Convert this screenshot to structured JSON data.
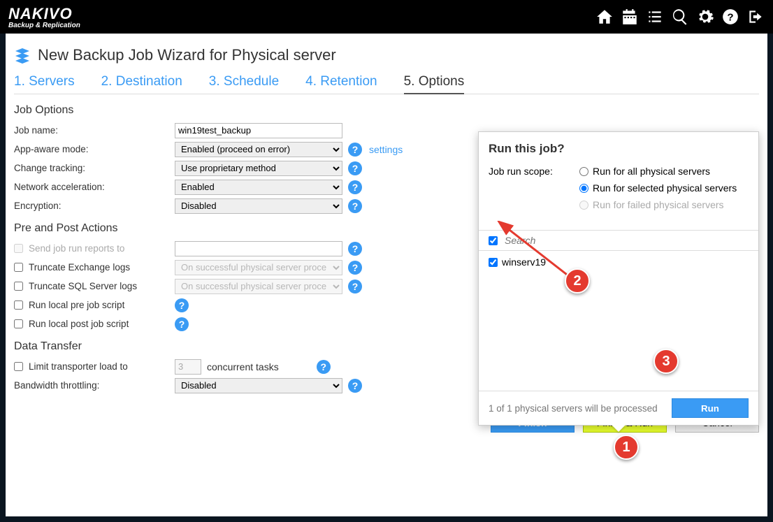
{
  "brand": {
    "name": "NAKIVO",
    "sub": "Backup & Replication"
  },
  "wizard": {
    "title": "New Backup Job Wizard for Physical server"
  },
  "steps": {
    "s1": "1. Servers",
    "s2": "2. Destination",
    "s3": "3. Schedule",
    "s4": "4. Retention",
    "s5": "5. Options"
  },
  "sections": {
    "jobOptions": "Job Options",
    "prePost": "Pre and Post Actions",
    "dataTransfer": "Data Transfer"
  },
  "labels": {
    "jobName": "Job name:",
    "appAware": "App-aware mode:",
    "changeTracking": "Change tracking:",
    "netAccel": "Network acceleration:",
    "encryption": "Encryption:",
    "sendReports": "Send job run reports to",
    "truncExchange": "Truncate Exchange logs",
    "truncSQL": "Truncate SQL Server logs",
    "preScript": "Run local pre job script",
    "postScript": "Run local post job script",
    "limitTransporter": "Limit transporter load to",
    "concurrent": "concurrent tasks",
    "bandwidth": "Bandwidth throttling:",
    "settingsLink": "settings"
  },
  "values": {
    "jobName": "win19test_backup",
    "appAware": "Enabled (proceed on error)",
    "changeTracking": "Use proprietary method",
    "netAccel": "Enabled",
    "encryption": "Disabled",
    "successProc": "On successful physical server proce",
    "limit": "3",
    "bandwidth": "Disabled"
  },
  "buttons": {
    "finish": "Finish",
    "finishRun": "Finish & Run",
    "cancel": "Cancel",
    "run": "Run"
  },
  "popup": {
    "title": "Run this job?",
    "scopeLabel": "Job run scope:",
    "radioAll": "Run for all physical servers",
    "radioSelected": "Run for selected physical servers",
    "radioFailed": "Run for failed physical servers",
    "searchPlaceholder": "Search",
    "server1": "winserv19",
    "status": "1 of 1 physical servers will be processed"
  },
  "annotations": {
    "a1": "1",
    "a2": "2",
    "a3": "3"
  }
}
